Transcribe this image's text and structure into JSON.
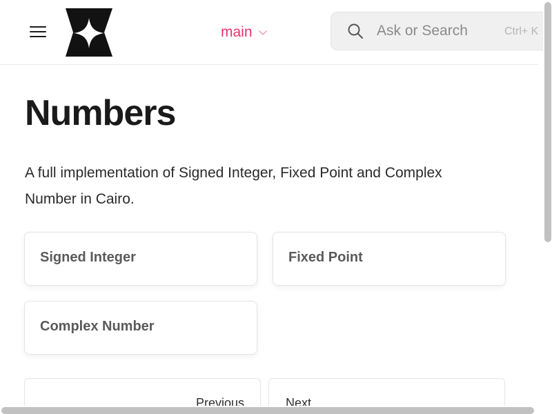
{
  "header": {
    "menu_icon": "hamburger-menu-icon",
    "logo_icon": "four-point-star-logo",
    "version": {
      "label": "main",
      "icon": "chevron-down-icon",
      "color": "#e8336c"
    },
    "search": {
      "icon": "search-icon",
      "placeholder": "Ask or Search",
      "shortcut": "Ctrl+ K"
    }
  },
  "main": {
    "title": "Numbers",
    "description": "A full implementation of Signed Integer, Fixed Point and Complex Number in Cairo.",
    "cards": [
      {
        "label": "Signed Integer"
      },
      {
        "label": "Fixed Point"
      },
      {
        "label": "Complex Number"
      }
    ],
    "pagination": {
      "previous_label": "Previous",
      "next_label": "Next"
    }
  }
}
